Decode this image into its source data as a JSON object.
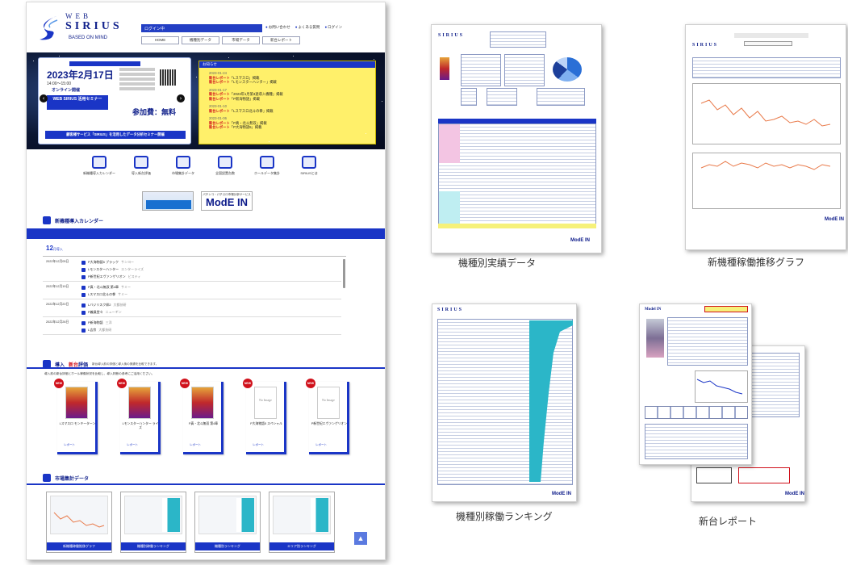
{
  "site": {
    "logo": {
      "line1": "WEB",
      "line2": "SIRIUS",
      "line3": "BASED ON MIND"
    },
    "header_bar_text": "ログイン中",
    "top_links": [
      "お問い合わせ",
      "よくある質問",
      "ログイン"
    ],
    "nav": [
      "HOME",
      "機種別データ",
      "市場データ",
      "新台レポート"
    ],
    "event": {
      "date": "2023年2月17日",
      "time": "14:00〜15:00",
      "note": "オンライン開催",
      "tag": "WEB SIRIUS 活用セミナー",
      "fee": "参加費：無料",
      "bar": "顧客様サービス「SIRIUS」を活用したデータ分析セミナー開催",
      "arrow_left": "‹",
      "arrow_right": "›"
    },
    "news": {
      "header": "お知らせ",
      "items": [
        {
          "date": "2023-01-24",
          "tag": "新台レポート",
          "text": "「Lスマスロ」掲載"
        },
        {
          "date": "2023-01-24",
          "tag": "新台レポート",
          "text": "「Lモンスターハンター」掲載"
        },
        {
          "date": "2023-01-17",
          "tag": "新台レポート",
          "text": "「2023年1月第3週導入機種」掲載"
        },
        {
          "date": "2023-01-17",
          "tag": "新台レポート",
          "text": "「P新海物語」掲載"
        },
        {
          "date": "2023-01-10",
          "tag": "新台レポート",
          "text": "「Lスマスロ北斗の拳」掲載"
        },
        {
          "date": "2023-01-06",
          "tag": "新台レポート",
          "text": "「P真・北斗無双」掲載"
        },
        {
          "date": "2023-01-06",
          "tag": "新台レポート",
          "text": "「P大海物語5」掲載"
        }
      ]
    },
    "icons": [
      "新機種導入カレンダー",
      "導入新台評価",
      "市場集計データ",
      "全国設置台数",
      "ホールデータ集計",
      "SIRIUSとは"
    ],
    "banner2": {
      "small": "パチンコ・パチスロ市場分析サービス",
      "big": "ModE IN"
    },
    "calendar": {
      "title": "新機種導入カレンダー",
      "month": "12",
      "month_suffix": "月導入",
      "rows": [
        {
          "date": "2022年12月05日",
          "items": [
            {
              "name": "P大海物語5 ブラック",
              "maker": "サンヨー"
            },
            {
              "name": "Lモンスターハンター",
              "maker": "エンターライズ"
            },
            {
              "name": "P新世紀エヴァンゲリオン",
              "maker": "ビスティ"
            }
          ]
        },
        {
          "date": "2022年12月19日",
          "items": [
            {
              "name": "P真・北斗無双 第4章",
              "maker": "サミー"
            },
            {
              "name": "Lスマスロ北斗の拳",
              "maker": "サミー"
            }
          ]
        },
        {
          "date": "2022年12月20日",
          "items": [
            {
              "name": "Lバジリスク絆2",
              "maker": "大都技研"
            },
            {
              "name": "P義風堂々",
              "maker": "ニューギン"
            }
          ]
        },
        {
          "date": "2022年12月26日",
          "items": [
            {
              "name": "P新海物語",
              "maker": "三洋"
            },
            {
              "name": "L吉宗",
              "maker": "大都技研"
            }
          ]
        }
      ]
    },
    "new_review": {
      "title_a": "導入",
      "title_hl": "新台",
      "title_b": "評価",
      "subtitle": "新台導入前の評価と導入後の実績を比較できます。",
      "desc": "導入前の新台評価とホール稼働状況を比較し、導入判断の参考にご活用ください。",
      "cards": [
        {
          "badge": "NEW",
          "name": "Lスマスロ モンキーターン",
          "link": "レポート",
          "noimg": false
        },
        {
          "badge": "NEW",
          "name": "Lモンスターハンター ライズ",
          "link": "レポート",
          "noimg": false
        },
        {
          "badge": "NEW",
          "name": "P真・北斗無双 第4章",
          "link": "レポート",
          "noimg": false
        },
        {
          "badge": "NEW",
          "name": "P大海物語5 スペシャル",
          "link": "レポート",
          "noimg": true,
          "noimg_text": "No Image"
        },
        {
          "badge": "NEW",
          "name": "P新世紀エヴァンゲリオン",
          "link": "レポート",
          "noimg": true,
          "noimg_text": "No Image"
        }
      ]
    },
    "market": {
      "title": "市場集計データ",
      "buttons": [
        "新機種稼働推移グラフ",
        "機種別稼働ランキング",
        "機種別ランキング",
        "エリア別ランキング"
      ]
    },
    "pagetop": "▲"
  },
  "thumbnails": [
    {
      "caption": "機種別実績データ",
      "logo": "SIRIUS",
      "footer": "ModE IN"
    },
    {
      "caption": "新機種稼働推移グラフ",
      "logo": "SIRIUS",
      "footer": "ModE IN"
    },
    {
      "caption": "機種別稼働ランキング",
      "logo": "SIRIUS",
      "footer": "ModE IN"
    },
    {
      "caption": "新台レポート",
      "logo": "Model IN",
      "footer": "ModE IN"
    }
  ]
}
